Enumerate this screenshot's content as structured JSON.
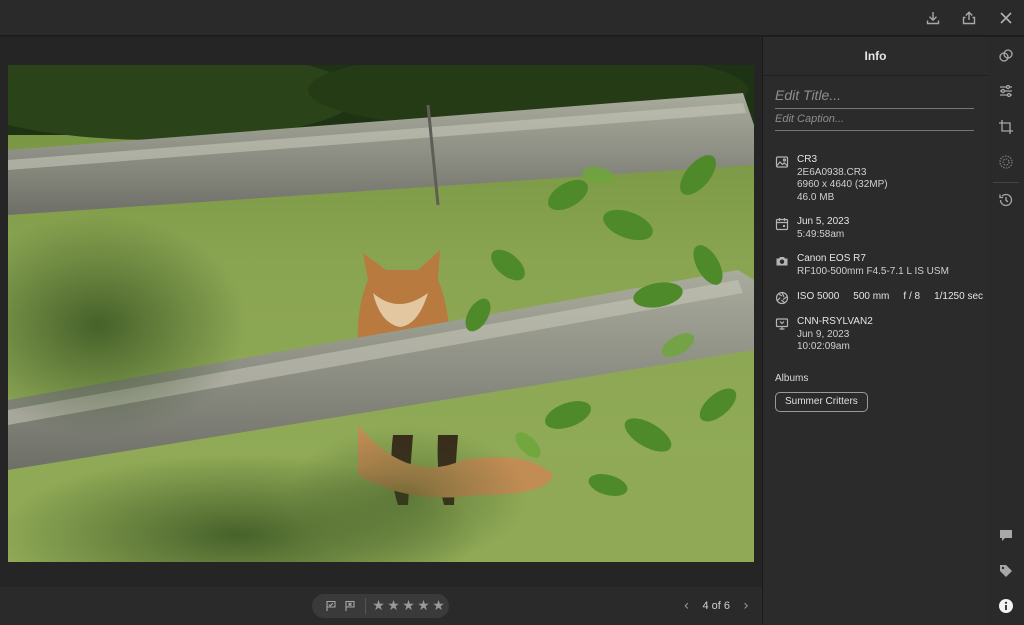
{
  "topbar": {
    "icons": [
      "download-icon",
      "share-icon",
      "close-icon"
    ]
  },
  "info": {
    "header": "Info",
    "title_placeholder": "Edit Title...",
    "caption_placeholder": "Edit Caption...",
    "file": {
      "format": "CR3",
      "filename": "2E6A0938.CR3",
      "dimensions": "6960 x 4640 (32MP)",
      "size": "46.0 MB"
    },
    "capture": {
      "date": "Jun 5, 2023",
      "time": "5:49:58am"
    },
    "camera": {
      "body": "Canon EOS R7",
      "lens": "RF100-500mm F4.5-7.1 L IS USM"
    },
    "exposure": {
      "iso": "ISO 5000",
      "focal_length": "500 mm",
      "aperture": "f / 8",
      "shutter": "1/1250 sec"
    },
    "import": {
      "device": "CNN-RSYLVAN2",
      "date": "Jun 9, 2023",
      "time": "10:02:09am"
    },
    "albums_label": "Albums",
    "albums": [
      "Summer Critters"
    ]
  },
  "bottombar": {
    "rating": 0,
    "max_rating": 5,
    "pager": "4 of 6"
  },
  "rightrail": {
    "icons": [
      "edit-presets-icon",
      "adjust-sliders-icon",
      "crop-icon",
      "masking-icon",
      "versions-history-icon",
      "comment-icon",
      "keyword-tag-icon",
      "info-icon"
    ],
    "active": "info-icon"
  },
  "colors": {
    "background": "#1f1f1f",
    "panel": "#2b2b2b",
    "text": "#d6d6d6"
  }
}
